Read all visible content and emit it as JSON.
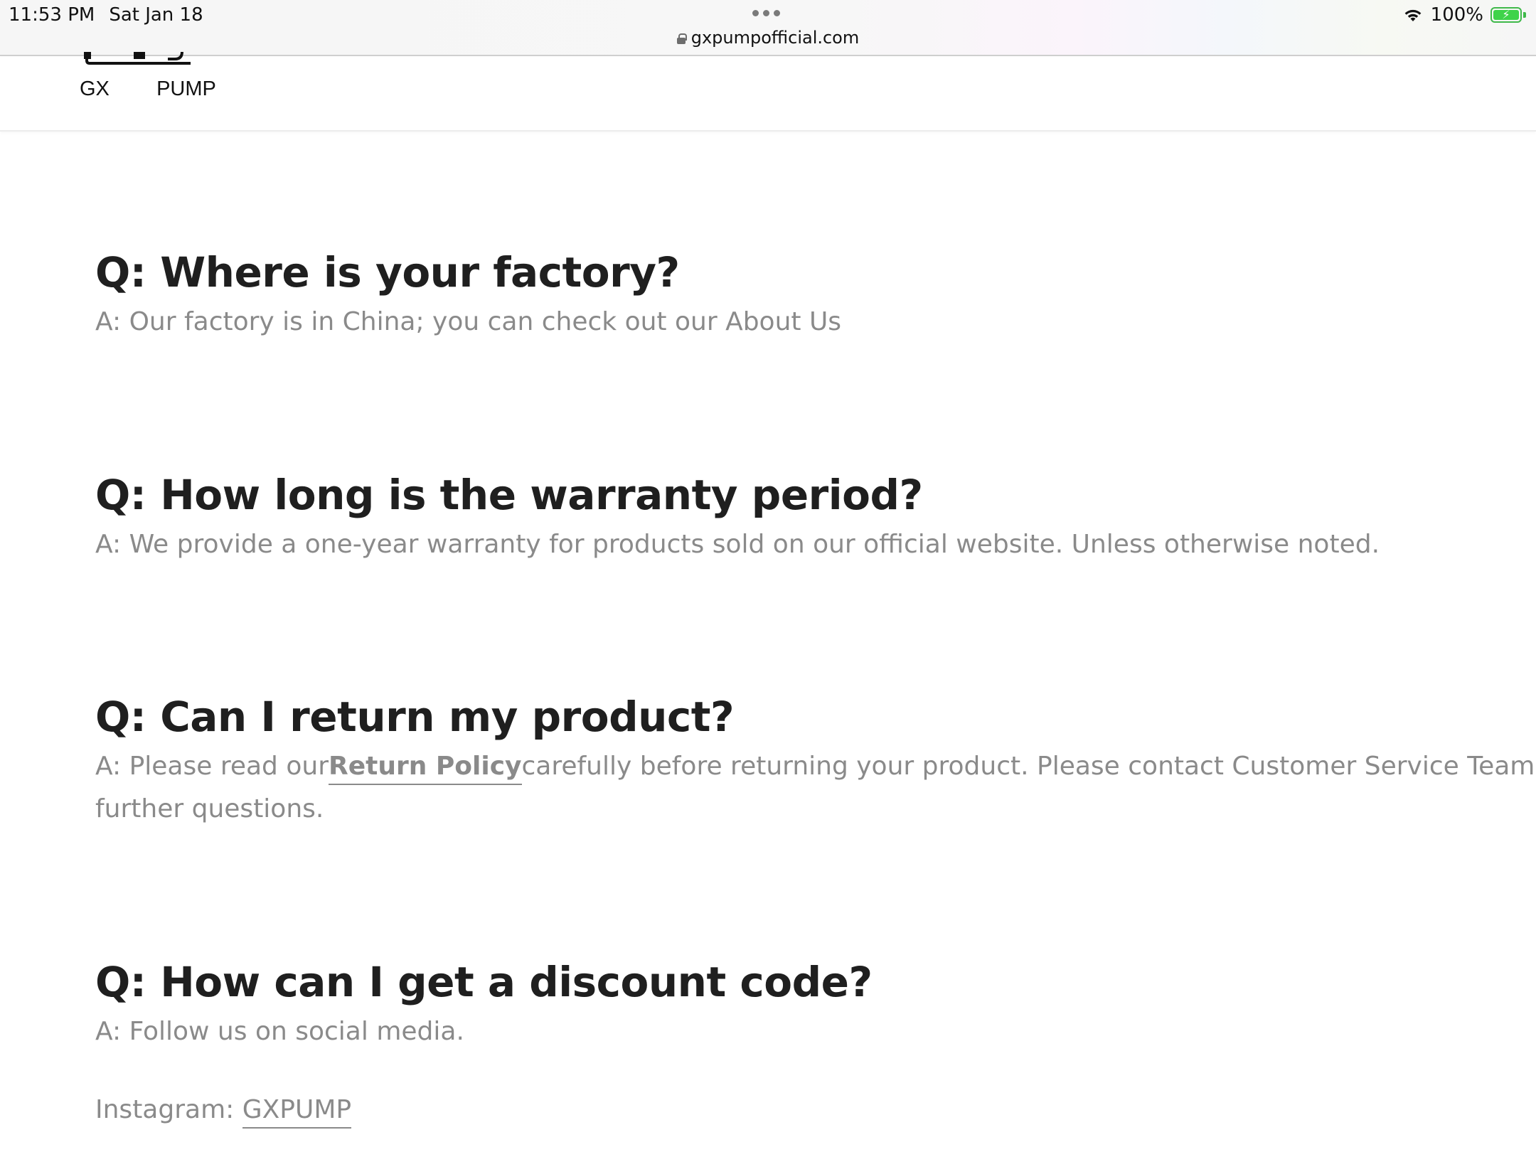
{
  "status_bar": {
    "time": "11:53 PM",
    "date": "Sat Jan 18",
    "url": "gxpumpofficial.com",
    "battery": "100%",
    "battery_level": 1.0
  },
  "header": {
    "logo_text": "GX   PUMP"
  },
  "faqs": [
    {
      "question": "Q: Where is your factory?",
      "answer": "A: Our factory is in China; you can check out our About Us"
    },
    {
      "question": "Q: How long is the warranty period?",
      "answer": "A: We provide a one-year warranty for products sold on our official website. Unless otherwise noted."
    },
    {
      "question": "Q: Can I return my product?",
      "answer_prefix": "A: Please read our",
      "answer_link": "Return Policy",
      "answer_suffix": "carefully before returning your product. Please contact Customer Service Team",
      "answer_line2": "further questions."
    },
    {
      "question": "Q: How can I get a discount code?",
      "answer": "A: Follow us on social media.",
      "social_label": "Instagram: ",
      "social_link": "GXPUMP"
    }
  ],
  "colors": {
    "question": "#1f1f1f",
    "answer": "#8a8a8a",
    "battery": "#3fd34a"
  }
}
